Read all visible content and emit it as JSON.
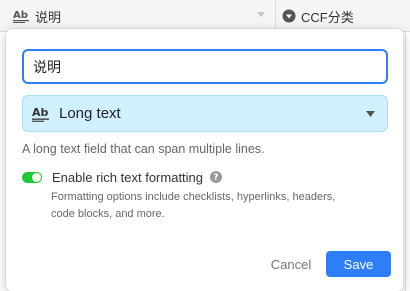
{
  "grid_header": {
    "columns": [
      {
        "label": "说明",
        "icon": "long-text-icon"
      },
      {
        "label": "CCF分类",
        "icon": "single-select-icon"
      }
    ]
  },
  "dialog": {
    "name_value": "说明",
    "field_type": {
      "label": "Long text",
      "icon": "long-text-icon"
    },
    "help_text": "A long text field that can span multiple lines.",
    "rich_text": {
      "enabled": true,
      "label": "Enable rich text formatting",
      "description": "Formatting options include checklists, hyperlinks, headers, code blocks, and more."
    },
    "buttons": {
      "cancel": "Cancel",
      "save": "Save"
    }
  },
  "colors": {
    "accent": "#2d7ff9",
    "select_bg": "#d0f0fd",
    "toggle_on": "#20c933"
  }
}
